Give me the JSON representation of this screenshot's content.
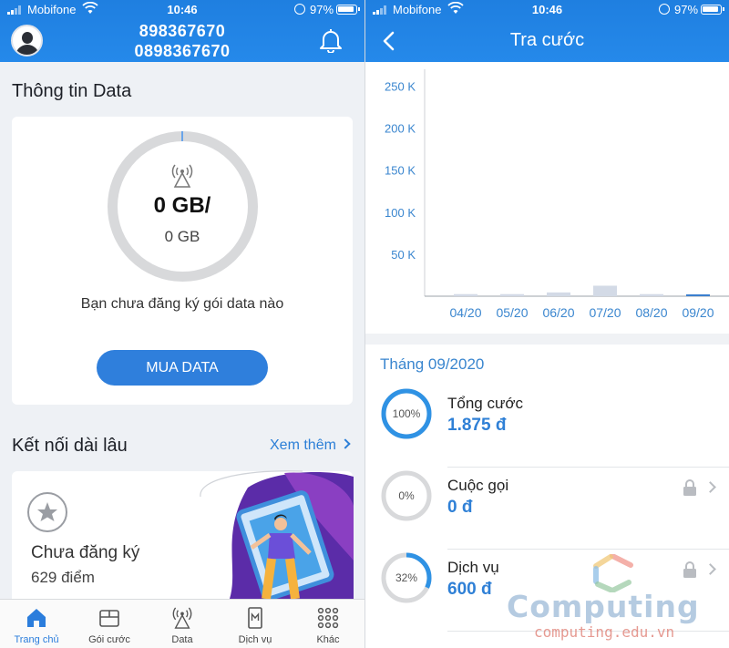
{
  "status_bar": {
    "carrier": "Mobifone",
    "time": "10:46",
    "battery": "97%"
  },
  "home": {
    "phone_primary": "898367670",
    "phone_secondary": "0898367670",
    "data_section_title": "Thông tin Data",
    "data_used": "0 GB/",
    "data_total": "0 GB",
    "no_package_note": "Bạn chưa đăng ký gói data nào",
    "buy_button": "MUA DATA",
    "loyalty_title": "Kết nối dài lâu",
    "see_more": "Xem thêm",
    "member_status": "Chưa đăng ký",
    "member_points": "629 điểm",
    "tabs": [
      {
        "label": "Trang chủ",
        "icon": "home-icon",
        "active": true
      },
      {
        "label": "Gói cước",
        "icon": "box-icon",
        "active": false
      },
      {
        "label": "Data",
        "icon": "antenna-icon",
        "active": false
      },
      {
        "label": "Dịch vụ",
        "icon": "phone-m-icon",
        "active": false
      },
      {
        "label": "Khác",
        "icon": "grid-icon",
        "active": false
      }
    ]
  },
  "charges": {
    "title": "Tra cước",
    "chart_data": {
      "type": "bar",
      "categories": [
        "04/20",
        "05/20",
        "06/20",
        "07/20",
        "08/20",
        "09/20"
      ],
      "values": [
        2500,
        2500,
        4500,
        12500,
        2500,
        1875
      ],
      "y_ticks": [
        "250 K",
        "200 K",
        "150 K",
        "100 K",
        "50 K"
      ],
      "ylim": [
        0,
        270000
      ],
      "selected_index": 5
    },
    "month_label": "Tháng 09/2020",
    "items": [
      {
        "label": "Tổng cước",
        "value": "1.875 đ",
        "percent_label": "100%",
        "percent": 100,
        "locked": false
      },
      {
        "label": "Cuộc gọi",
        "value": "0 đ",
        "percent_label": "0%",
        "percent": 0,
        "locked": true
      },
      {
        "label": "Dịch vụ",
        "value": "600 đ",
        "percent_label": "32%",
        "percent": 32,
        "locked": true
      }
    ]
  },
  "watermark": {
    "name": "Computing",
    "url": "computing.edu.vn"
  },
  "colors": {
    "header": "#2286e8",
    "accent": "#2f80d6",
    "ring_gray": "#d8d9db",
    "bar_gray": "#d3dae6",
    "bar_selected": "#3b7fcf"
  }
}
